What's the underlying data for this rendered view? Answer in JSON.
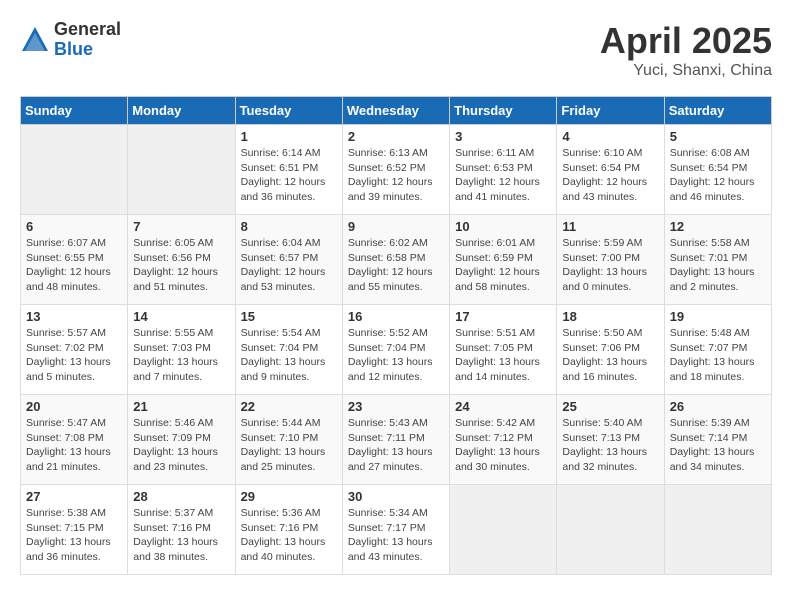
{
  "header": {
    "logo_general": "General",
    "logo_blue": "Blue",
    "title": "April 2025",
    "subtitle": "Yuci, Shanxi, China"
  },
  "days_of_week": [
    "Sunday",
    "Monday",
    "Tuesday",
    "Wednesday",
    "Thursday",
    "Friday",
    "Saturday"
  ],
  "weeks": [
    [
      {
        "day": "",
        "info": ""
      },
      {
        "day": "",
        "info": ""
      },
      {
        "day": "1",
        "info": "Sunrise: 6:14 AM\nSunset: 6:51 PM\nDaylight: 12 hours and 36 minutes."
      },
      {
        "day": "2",
        "info": "Sunrise: 6:13 AM\nSunset: 6:52 PM\nDaylight: 12 hours and 39 minutes."
      },
      {
        "day": "3",
        "info": "Sunrise: 6:11 AM\nSunset: 6:53 PM\nDaylight: 12 hours and 41 minutes."
      },
      {
        "day": "4",
        "info": "Sunrise: 6:10 AM\nSunset: 6:54 PM\nDaylight: 12 hours and 43 minutes."
      },
      {
        "day": "5",
        "info": "Sunrise: 6:08 AM\nSunset: 6:54 PM\nDaylight: 12 hours and 46 minutes."
      }
    ],
    [
      {
        "day": "6",
        "info": "Sunrise: 6:07 AM\nSunset: 6:55 PM\nDaylight: 12 hours and 48 minutes."
      },
      {
        "day": "7",
        "info": "Sunrise: 6:05 AM\nSunset: 6:56 PM\nDaylight: 12 hours and 51 minutes."
      },
      {
        "day": "8",
        "info": "Sunrise: 6:04 AM\nSunset: 6:57 PM\nDaylight: 12 hours and 53 minutes."
      },
      {
        "day": "9",
        "info": "Sunrise: 6:02 AM\nSunset: 6:58 PM\nDaylight: 12 hours and 55 minutes."
      },
      {
        "day": "10",
        "info": "Sunrise: 6:01 AM\nSunset: 6:59 PM\nDaylight: 12 hours and 58 minutes."
      },
      {
        "day": "11",
        "info": "Sunrise: 5:59 AM\nSunset: 7:00 PM\nDaylight: 13 hours and 0 minutes."
      },
      {
        "day": "12",
        "info": "Sunrise: 5:58 AM\nSunset: 7:01 PM\nDaylight: 13 hours and 2 minutes."
      }
    ],
    [
      {
        "day": "13",
        "info": "Sunrise: 5:57 AM\nSunset: 7:02 PM\nDaylight: 13 hours and 5 minutes."
      },
      {
        "day": "14",
        "info": "Sunrise: 5:55 AM\nSunset: 7:03 PM\nDaylight: 13 hours and 7 minutes."
      },
      {
        "day": "15",
        "info": "Sunrise: 5:54 AM\nSunset: 7:04 PM\nDaylight: 13 hours and 9 minutes."
      },
      {
        "day": "16",
        "info": "Sunrise: 5:52 AM\nSunset: 7:04 PM\nDaylight: 13 hours and 12 minutes."
      },
      {
        "day": "17",
        "info": "Sunrise: 5:51 AM\nSunset: 7:05 PM\nDaylight: 13 hours and 14 minutes."
      },
      {
        "day": "18",
        "info": "Sunrise: 5:50 AM\nSunset: 7:06 PM\nDaylight: 13 hours and 16 minutes."
      },
      {
        "day": "19",
        "info": "Sunrise: 5:48 AM\nSunset: 7:07 PM\nDaylight: 13 hours and 18 minutes."
      }
    ],
    [
      {
        "day": "20",
        "info": "Sunrise: 5:47 AM\nSunset: 7:08 PM\nDaylight: 13 hours and 21 minutes."
      },
      {
        "day": "21",
        "info": "Sunrise: 5:46 AM\nSunset: 7:09 PM\nDaylight: 13 hours and 23 minutes."
      },
      {
        "day": "22",
        "info": "Sunrise: 5:44 AM\nSunset: 7:10 PM\nDaylight: 13 hours and 25 minutes."
      },
      {
        "day": "23",
        "info": "Sunrise: 5:43 AM\nSunset: 7:11 PM\nDaylight: 13 hours and 27 minutes."
      },
      {
        "day": "24",
        "info": "Sunrise: 5:42 AM\nSunset: 7:12 PM\nDaylight: 13 hours and 30 minutes."
      },
      {
        "day": "25",
        "info": "Sunrise: 5:40 AM\nSunset: 7:13 PM\nDaylight: 13 hours and 32 minutes."
      },
      {
        "day": "26",
        "info": "Sunrise: 5:39 AM\nSunset: 7:14 PM\nDaylight: 13 hours and 34 minutes."
      }
    ],
    [
      {
        "day": "27",
        "info": "Sunrise: 5:38 AM\nSunset: 7:15 PM\nDaylight: 13 hours and 36 minutes."
      },
      {
        "day": "28",
        "info": "Sunrise: 5:37 AM\nSunset: 7:16 PM\nDaylight: 13 hours and 38 minutes."
      },
      {
        "day": "29",
        "info": "Sunrise: 5:36 AM\nSunset: 7:16 PM\nDaylight: 13 hours and 40 minutes."
      },
      {
        "day": "30",
        "info": "Sunrise: 5:34 AM\nSunset: 7:17 PM\nDaylight: 13 hours and 43 minutes."
      },
      {
        "day": "",
        "info": ""
      },
      {
        "day": "",
        "info": ""
      },
      {
        "day": "",
        "info": ""
      }
    ]
  ]
}
